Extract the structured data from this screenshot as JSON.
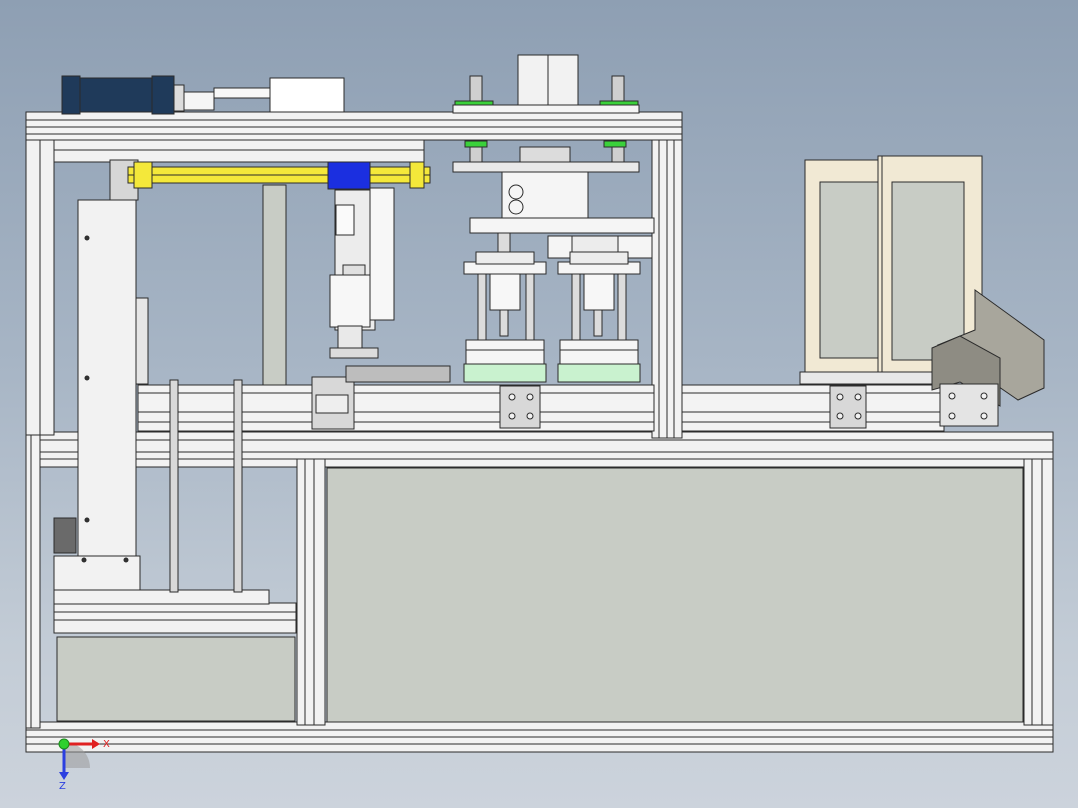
{
  "viewport": {
    "background_top": "#8e9fb3",
    "background_bottom": "#ccd3dc",
    "model": "machine-assembly-front-view"
  },
  "colors": {
    "frame": "#f2f2f2",
    "frame_edge": "#2b2b2b",
    "panel": "#c8ccc5",
    "actuator_yellow": "#f4e83a",
    "slider_blue": "#1b2fe0",
    "motor_navy": "#1f3a5a",
    "die_green": "#c9f2cf",
    "bracket_gray": "#a8a69c",
    "window_beige": "#f1e9d4"
  },
  "triad": {
    "x_label": "X",
    "z_label": "Z",
    "icons": [
      "x-axis-arrow-icon",
      "z-axis-arrow-icon",
      "origin-sphere-icon"
    ]
  }
}
